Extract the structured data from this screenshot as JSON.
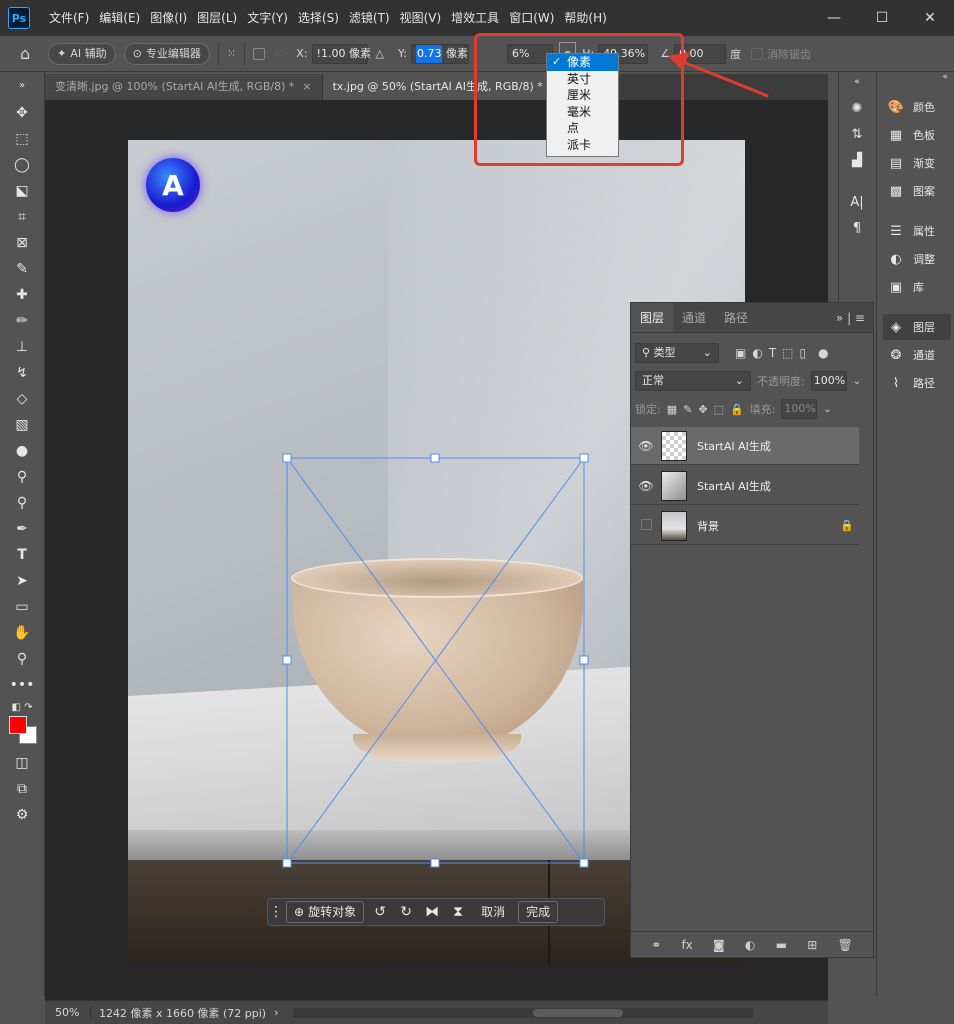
{
  "app": {
    "logo": "Ps"
  },
  "menu": [
    "文件(F)",
    "编辑(E)",
    "图像(I)",
    "图层(L)",
    "文字(Y)",
    "选择(S)",
    "滤镜(T)",
    "视图(V)",
    "增效工具",
    "窗口(W)",
    "帮助(H)"
  ],
  "window_controls": {
    "minimize": "—",
    "maximize": "☐",
    "close": "✕"
  },
  "options": {
    "ai_assist": "AI 辅助",
    "pro_editor": "专业编辑器",
    "x_label": "X:",
    "x_value": "!1.00 像素",
    "y_label": "Y:",
    "y_value_selected": "0.73",
    "y_unit": "像素",
    "w_value": "6%",
    "h_label": "H:",
    "h_value": "49.36%",
    "angle_value": "0.00",
    "angle_unit": "度",
    "anti_alias": "消除锯齿"
  },
  "unit_dropdown": {
    "items": [
      "像素",
      "英寸",
      "厘米",
      "毫米",
      "点",
      "派卡"
    ],
    "selected_index": 0,
    "check": "✓"
  },
  "tabs": [
    {
      "label": "变清晰.jpg @ 100% (StartAI AI生成, RGB/8) *",
      "close": "×",
      "active": false
    },
    {
      "label": "tx.jpg @ 50% (StartAI AI生成, RGB/8) *",
      "close": "×",
      "active": true
    }
  ],
  "canvas": {
    "logo_letter": "A"
  },
  "task_bar": {
    "rotate_label": "旋转对象",
    "cancel_label": "取消",
    "done_label": "完成"
  },
  "dock": {
    "items": [
      {
        "icon": "palette-icon",
        "glyph": "🎨",
        "label": "颜色"
      },
      {
        "icon": "swatches-icon",
        "glyph": "▦",
        "label": "色板"
      },
      {
        "icon": "gradient-icon",
        "glyph": "▤",
        "label": "渐变"
      },
      {
        "icon": "patterns-icon",
        "glyph": "▩",
        "label": "图案"
      },
      {
        "icon": "properties-icon",
        "glyph": "☰",
        "label": "属性"
      },
      {
        "icon": "adjustments-icon",
        "glyph": "◐",
        "label": "调整"
      },
      {
        "icon": "libraries-icon",
        "glyph": "▣",
        "label": "库"
      },
      {
        "icon": "layers-icon",
        "glyph": "◈",
        "label": "图层"
      },
      {
        "icon": "channels-icon",
        "glyph": "❂",
        "label": "通道"
      },
      {
        "icon": "paths-icon",
        "glyph": "⌇",
        "label": "路径"
      }
    ]
  },
  "layers_panel": {
    "tabs": [
      "图层",
      "通道",
      "路径"
    ],
    "filter_label": "类型",
    "blend_mode": "正常",
    "opacity_label": "不透明度:",
    "opacity_value": "100%",
    "lock_label": "锁定:",
    "fill_label": "填充:",
    "fill_value": "100%",
    "layers": [
      {
        "name": "StartAI AI生成",
        "visible": true,
        "thumb": "checker",
        "selected": true,
        "locked": false
      },
      {
        "name": "StartAI AI生成",
        "visible": true,
        "thumb": "grey",
        "selected": false,
        "locked": false
      },
      {
        "name": "背景",
        "visible": false,
        "thumb": "photo",
        "selected": false,
        "locked": true
      }
    ]
  },
  "status": {
    "zoom": "50%",
    "doc_info": "1242 像素 x 1660 像素 (72 ppi)",
    "arrow": "›"
  },
  "colors": {
    "annotation": "#e03c2f",
    "foreground": "#ff0000",
    "background": "#ffffff",
    "transform_line": "#4d8df5"
  }
}
